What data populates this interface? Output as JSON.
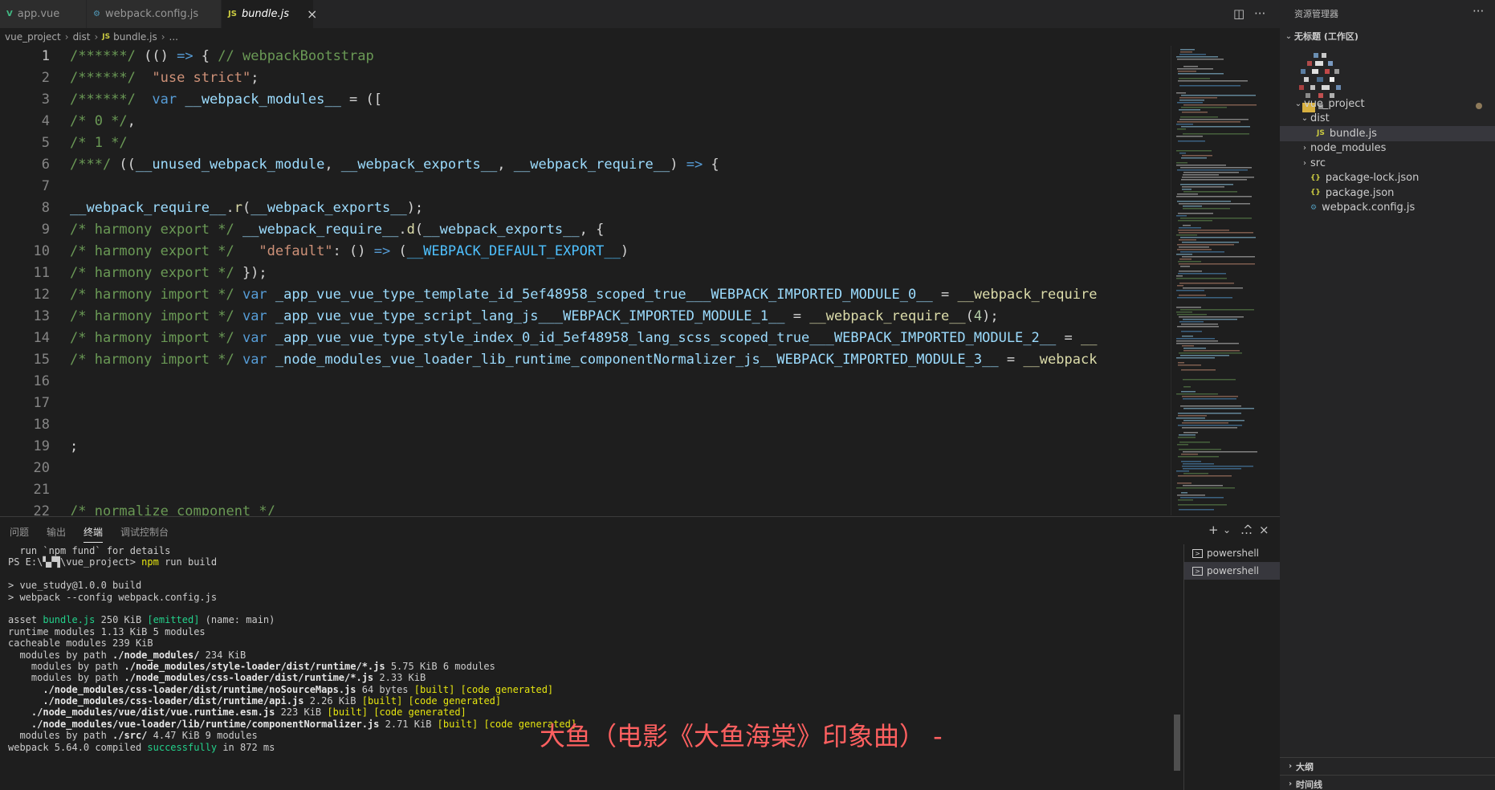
{
  "tabs": [
    {
      "icon": "V",
      "label": "app.vue",
      "color": "#41b883"
    },
    {
      "icon": "⚙",
      "label": "webpack.config.js",
      "color": "#519aba"
    },
    {
      "icon": "JS",
      "label": "bundle.js",
      "color": "#cbcb41",
      "close": "×"
    }
  ],
  "breadcrumb": [
    "vue_project",
    "dist",
    "bundle.js",
    "..."
  ],
  "editor": {
    "line_numbers": [
      "1",
      "2",
      "3",
      "4",
      "5",
      "6",
      "7",
      "8",
      "9",
      "10",
      "11",
      "12",
      "13",
      "14",
      "15",
      "16",
      "17",
      "18",
      "19",
      "20",
      "21",
      "22"
    ],
    "lines": [
      [
        {
          "c": "c-com",
          "t": "/******/"
        },
        {
          "c": "",
          "t": " (() "
        },
        {
          "c": "c-kw",
          "t": "=>"
        },
        {
          "c": "",
          "t": " { "
        },
        {
          "c": "c-com",
          "t": "// webpackBootstrap"
        }
      ],
      [
        {
          "c": "c-com",
          "t": "/******/"
        },
        {
          "c": "",
          "t": "  "
        },
        {
          "c": "c-str",
          "t": "\"use strict\""
        },
        {
          "c": "",
          "t": ";"
        }
      ],
      [
        {
          "c": "c-com",
          "t": "/******/"
        },
        {
          "c": "",
          "t": "  "
        },
        {
          "c": "c-kw",
          "t": "var"
        },
        {
          "c": "",
          "t": " "
        },
        {
          "c": "c-var",
          "t": "__webpack_modules__"
        },
        {
          "c": "",
          "t": " = (["
        }
      ],
      [
        {
          "c": "c-com",
          "t": "/* 0 */"
        },
        {
          "c": "",
          "t": ","
        }
      ],
      [
        {
          "c": "c-com",
          "t": "/* 1 */"
        }
      ],
      [
        {
          "c": "c-com",
          "t": "/***/"
        },
        {
          "c": "",
          "t": " (("
        },
        {
          "c": "c-var",
          "t": "__unused_webpack_module"
        },
        {
          "c": "",
          "t": ", "
        },
        {
          "c": "c-var",
          "t": "__webpack_exports__"
        },
        {
          "c": "",
          "t": ", "
        },
        {
          "c": "c-var",
          "t": "__webpack_require__"
        },
        {
          "c": "",
          "t": ") "
        },
        {
          "c": "c-kw",
          "t": "=>"
        },
        {
          "c": "",
          "t": " {"
        }
      ],
      [],
      [
        {
          "c": "c-var",
          "t": "__webpack_require__"
        },
        {
          "c": "",
          "t": "."
        },
        {
          "c": "c-fn",
          "t": "r"
        },
        {
          "c": "",
          "t": "("
        },
        {
          "c": "c-var",
          "t": "__webpack_exports__"
        },
        {
          "c": "",
          "t": ");"
        }
      ],
      [
        {
          "c": "c-com",
          "t": "/* harmony export */"
        },
        {
          "c": "",
          "t": " "
        },
        {
          "c": "c-var",
          "t": "__webpack_require__"
        },
        {
          "c": "",
          "t": "."
        },
        {
          "c": "c-fn",
          "t": "d"
        },
        {
          "c": "",
          "t": "("
        },
        {
          "c": "c-var",
          "t": "__webpack_exports__"
        },
        {
          "c": "",
          "t": ", {"
        }
      ],
      [
        {
          "c": "c-com",
          "t": "/* harmony export */"
        },
        {
          "c": "",
          "t": "   "
        },
        {
          "c": "c-str",
          "t": "\"default\""
        },
        {
          "c": "",
          "t": ": () "
        },
        {
          "c": "c-kw",
          "t": "=>"
        },
        {
          "c": "",
          "t": " ("
        },
        {
          "c": "c-const",
          "t": "__WEBPACK_DEFAULT_EXPORT__"
        },
        {
          "c": "",
          "t": ")"
        }
      ],
      [
        {
          "c": "c-com",
          "t": "/* harmony export */"
        },
        {
          "c": "",
          "t": " });"
        }
      ],
      [
        {
          "c": "c-com",
          "t": "/* harmony import */"
        },
        {
          "c": "",
          "t": " "
        },
        {
          "c": "c-kw",
          "t": "var"
        },
        {
          "c": "",
          "t": " "
        },
        {
          "c": "c-var",
          "t": "_app_vue_vue_type_template_id_5ef48958_scoped_true___WEBPACK_IMPORTED_MODULE_0__"
        },
        {
          "c": "",
          "t": " = "
        },
        {
          "c": "c-fn",
          "t": "__webpack_require"
        }
      ],
      [
        {
          "c": "c-com",
          "t": "/* harmony import */"
        },
        {
          "c": "",
          "t": " "
        },
        {
          "c": "c-kw",
          "t": "var"
        },
        {
          "c": "",
          "t": " "
        },
        {
          "c": "c-var",
          "t": "_app_vue_vue_type_script_lang_js___WEBPACK_IMPORTED_MODULE_1__"
        },
        {
          "c": "",
          "t": " = "
        },
        {
          "c": "c-fn",
          "t": "__webpack_require__"
        },
        {
          "c": "",
          "t": "("
        },
        {
          "c": "c-num",
          "t": "4"
        },
        {
          "c": "",
          "t": ");"
        }
      ],
      [
        {
          "c": "c-com",
          "t": "/* harmony import */"
        },
        {
          "c": "",
          "t": " "
        },
        {
          "c": "c-kw",
          "t": "var"
        },
        {
          "c": "",
          "t": " "
        },
        {
          "c": "c-var",
          "t": "_app_vue_vue_type_style_index_0_id_5ef48958_lang_scss_scoped_true___WEBPACK_IMPORTED_MODULE_2__"
        },
        {
          "c": "",
          "t": " = "
        },
        {
          "c": "c-fn",
          "t": "__"
        }
      ],
      [
        {
          "c": "c-com",
          "t": "/* harmony import */"
        },
        {
          "c": "",
          "t": " "
        },
        {
          "c": "c-kw",
          "t": "var"
        },
        {
          "c": "",
          "t": " "
        },
        {
          "c": "c-var",
          "t": "_node_modules_vue_loader_lib_runtime_componentNormalizer_js__WEBPACK_IMPORTED_MODULE_3__"
        },
        {
          "c": "",
          "t": " = "
        },
        {
          "c": "c-fn",
          "t": "__webpack"
        }
      ],
      [],
      [],
      [],
      [
        {
          "c": "",
          "t": ";"
        }
      ],
      [],
      [],
      [
        {
          "c": "c-com",
          "t": "/* normalize component */"
        }
      ]
    ]
  },
  "panel": {
    "tabs": [
      "问题",
      "输出",
      "终端",
      "调试控制台"
    ],
    "active_tab": 2,
    "actions": [
      "+",
      "⌄",
      "…",
      "^",
      "×"
    ],
    "terminal_lines": [
      [
        {
          "c": "",
          "t": "  run `npm fund` for details"
        }
      ],
      [
        {
          "c": "",
          "t": "PS E:\\▚▞▜\\vue_project> "
        },
        {
          "c": "t-y",
          "t": "npm"
        },
        {
          "c": "",
          "t": " run build"
        }
      ],
      [],
      [
        {
          "c": "",
          "t": "> vue_study@1.0.0 build"
        }
      ],
      [
        {
          "c": "",
          "t": "> webpack --config webpack.config.js"
        }
      ],
      [],
      [
        {
          "c": "",
          "t": "asset "
        },
        {
          "c": "t-g",
          "t": "bundle.js"
        },
        {
          "c": "",
          "t": " 250 KiB "
        },
        {
          "c": "t-g",
          "t": "[emitted]"
        },
        {
          "c": "",
          "t": " (name: main)"
        }
      ],
      [
        {
          "c": "",
          "t": "runtime modules 1.13 KiB 5 modules"
        }
      ],
      [
        {
          "c": "",
          "t": "cacheable modules 239 KiB"
        }
      ],
      [
        {
          "c": "",
          "t": "  modules by path "
        },
        {
          "c": "t-b",
          "t": "./node_modules/"
        },
        {
          "c": "",
          "t": " 234 KiB"
        }
      ],
      [
        {
          "c": "",
          "t": "    modules by path "
        },
        {
          "c": "t-b",
          "t": "./node_modules/style-loader/dist/runtime/*.js"
        },
        {
          "c": "",
          "t": " 5.75 KiB 6 modules"
        }
      ],
      [
        {
          "c": "",
          "t": "    modules by path "
        },
        {
          "c": "t-b",
          "t": "./node_modules/css-loader/dist/runtime/*.js"
        },
        {
          "c": "",
          "t": " 2.33 KiB"
        }
      ],
      [
        {
          "c": "",
          "t": "      "
        },
        {
          "c": "t-b",
          "t": "./node_modules/css-loader/dist/runtime/noSourceMaps.js"
        },
        {
          "c": "",
          "t": " 64 bytes "
        },
        {
          "c": "t-y",
          "t": "[built]"
        },
        {
          "c": "",
          "t": " "
        },
        {
          "c": "t-y",
          "t": "[code generated]"
        }
      ],
      [
        {
          "c": "",
          "t": "      "
        },
        {
          "c": "t-b",
          "t": "./node_modules/css-loader/dist/runtime/api.js"
        },
        {
          "c": "",
          "t": " 2.26 KiB "
        },
        {
          "c": "t-y",
          "t": "[built]"
        },
        {
          "c": "",
          "t": " "
        },
        {
          "c": "t-y",
          "t": "[code generated]"
        }
      ],
      [
        {
          "c": "",
          "t": "    "
        },
        {
          "c": "t-b",
          "t": "./node_modules/vue/dist/vue.runtime.esm.js"
        },
        {
          "c": "",
          "t": " 223 KiB "
        },
        {
          "c": "t-y",
          "t": "[built]"
        },
        {
          "c": "",
          "t": " "
        },
        {
          "c": "t-y",
          "t": "[code generated]"
        }
      ],
      [
        {
          "c": "",
          "t": "    "
        },
        {
          "c": "t-b",
          "t": "./node_modules/vue-loader/lib/runtime/componentNormalizer.js"
        },
        {
          "c": "",
          "t": " 2.71 KiB "
        },
        {
          "c": "t-y",
          "t": "[built]"
        },
        {
          "c": "",
          "t": " "
        },
        {
          "c": "t-y",
          "t": "[code generated]"
        }
      ],
      [
        {
          "c": "",
          "t": "  modules by path "
        },
        {
          "c": "t-b",
          "t": "./src/"
        },
        {
          "c": "",
          "t": " 4.47 KiB 9 modules"
        }
      ],
      [
        {
          "c": "",
          "t": "webpack 5.64.0 compiled "
        },
        {
          "c": "t-g",
          "t": "successfully"
        },
        {
          "c": "",
          "t": " in 872 ms"
        }
      ]
    ],
    "terminals": [
      "powershell",
      "powershell"
    ],
    "lyric": "大鱼（电影《大鱼海棠》印象曲） -"
  },
  "sidebar": {
    "title": "资源管理器",
    "more": "···",
    "workspace": "无标题 (工作区)",
    "tree": [
      {
        "label": "vue_project",
        "chev": "⌄",
        "icon": "",
        "indent": 0
      },
      {
        "label": "dist",
        "chev": "⌄",
        "icon": "",
        "indent": 1
      },
      {
        "label": "bundle.js",
        "chev": "",
        "icon": "JS",
        "iconColor": "#cbcb41",
        "indent": 2,
        "selected": true
      },
      {
        "label": "node_modules",
        "chev": "›",
        "icon": "",
        "indent": 1
      },
      {
        "label": "src",
        "chev": "›",
        "icon": "",
        "indent": 1
      },
      {
        "label": "package-lock.json",
        "chev": "",
        "icon": "{}",
        "iconColor": "#cbcb41",
        "indent": 1
      },
      {
        "label": "package.json",
        "chev": "",
        "icon": "{}",
        "iconColor": "#cbcb41",
        "indent": 1
      },
      {
        "label": "webpack.config.js",
        "chev": "",
        "icon": "⚙",
        "iconColor": "#519aba",
        "indent": 1
      }
    ],
    "sections": [
      "大纲",
      "时间线"
    ]
  }
}
